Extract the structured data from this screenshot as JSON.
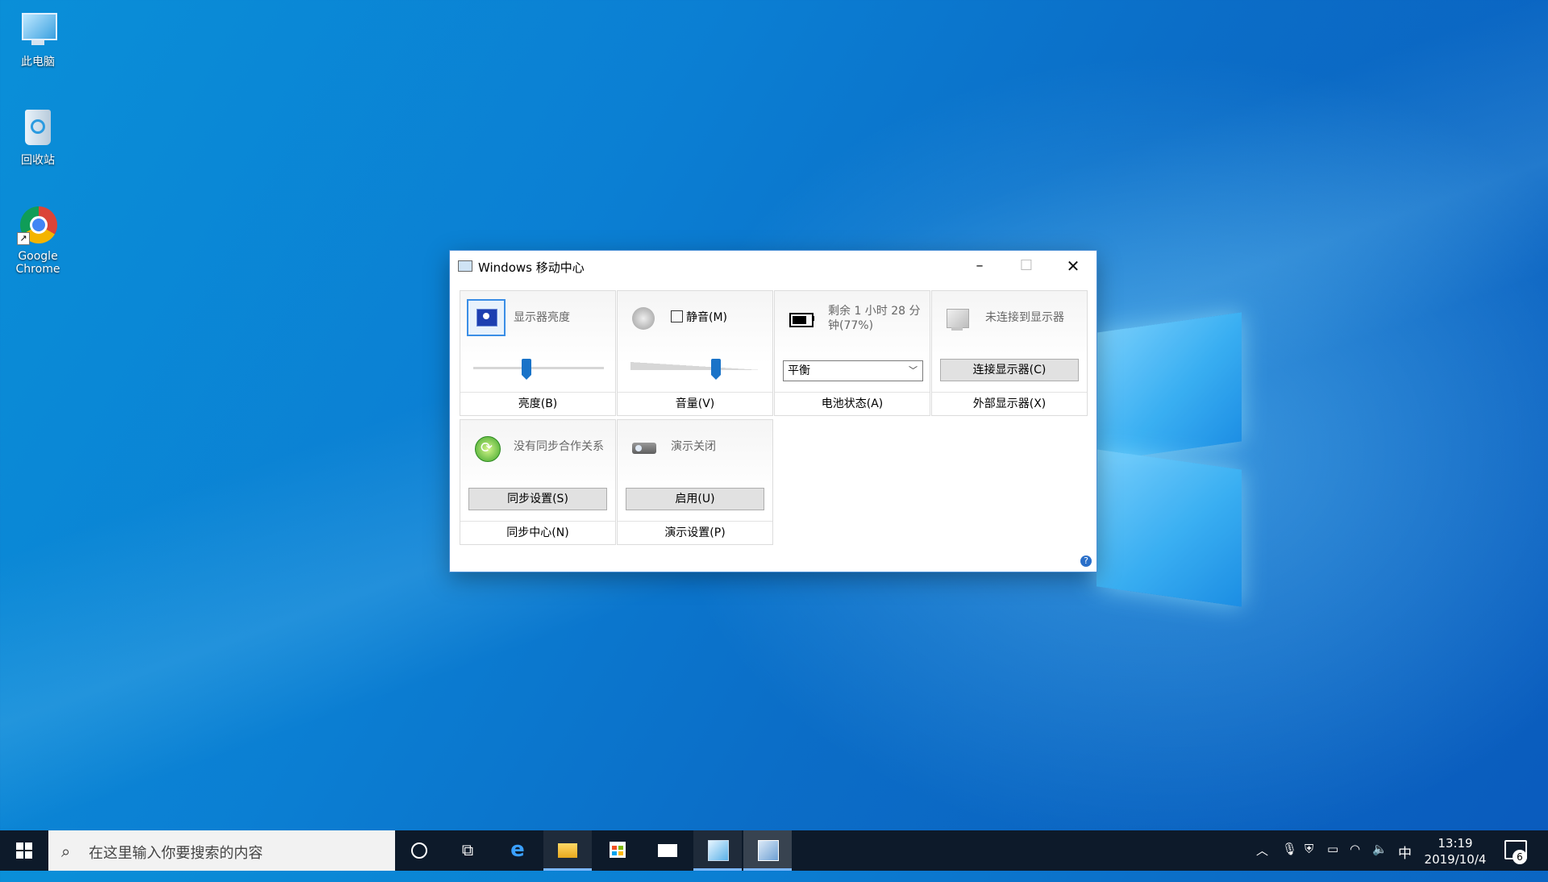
{
  "desktop": {
    "icons": [
      {
        "label": "此电脑"
      },
      {
        "label": "回收站"
      },
      {
        "label": "Google Chrome"
      }
    ]
  },
  "window": {
    "title": "Windows 移动中心",
    "tiles": {
      "brightness": {
        "status": "显示器亮度",
        "label": "亮度(B)",
        "level_percent": 40
      },
      "volume": {
        "mute_label": "静音(M)",
        "muted": false,
        "label": "音量(V)",
        "level_percent": 66
      },
      "battery": {
        "status_line1": "剩余 1 小时 28 分",
        "status_line2": "钟(77%)",
        "plan": "平衡",
        "label": "电池状态(A)"
      },
      "display": {
        "status": "未连接到显示器",
        "button": "连接显示器(C)",
        "label": "外部显示器(X)"
      },
      "sync": {
        "status": "没有同步合作关系",
        "button": "同步设置(S)",
        "label": "同步中心(N)"
      },
      "presentation": {
        "status": "演示关闭",
        "button": "启用(U)",
        "label": "演示设置(P)"
      }
    }
  },
  "taskbar": {
    "search_placeholder": "在这里输入你要搜索的内容",
    "time": "13:19",
    "date": "2019/10/4",
    "ime": "中",
    "notification_count": "6"
  }
}
